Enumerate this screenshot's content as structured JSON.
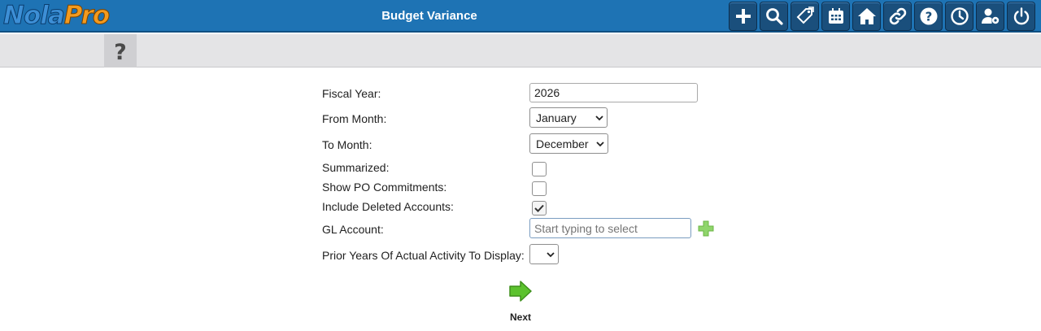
{
  "header": {
    "logo_part1": "Nola",
    "logo_part2": "Pro",
    "title": "Budget Variance",
    "toolbar_icons": [
      "plus-icon",
      "search-icon",
      "tag-icon",
      "calendar-icon",
      "home-icon",
      "link-icon",
      "help-icon",
      "clock-icon",
      "user-settings-icon",
      "power-icon"
    ]
  },
  "subbar": {
    "help_tab_icon": "question-mark-icon"
  },
  "form": {
    "fiscal_year_label": "Fiscal Year:",
    "fiscal_year_value": "2026",
    "from_month_label": "From Month:",
    "from_month_value": "January",
    "to_month_label": "To Month:",
    "to_month_value": "December",
    "summarized_label": "Summarized:",
    "summarized_checked": false,
    "show_po_label": "Show PO Commitments:",
    "show_po_checked": false,
    "include_deleted_label": "Include Deleted Accounts:",
    "include_deleted_checked": true,
    "gl_account_label": "GL Account:",
    "gl_account_placeholder": "Start typing to select",
    "prior_years_label": "Prior Years Of Actual Activity To Display:",
    "prior_years_value": "",
    "next_label": "Next"
  },
  "colors": {
    "header_bg": "#1e73b4",
    "icon_button_bg": "#1a4f7c",
    "subbar_bg": "#e4e4e6",
    "next_arrow": "#5cc22e",
    "add_icon": "#8fd56b"
  }
}
